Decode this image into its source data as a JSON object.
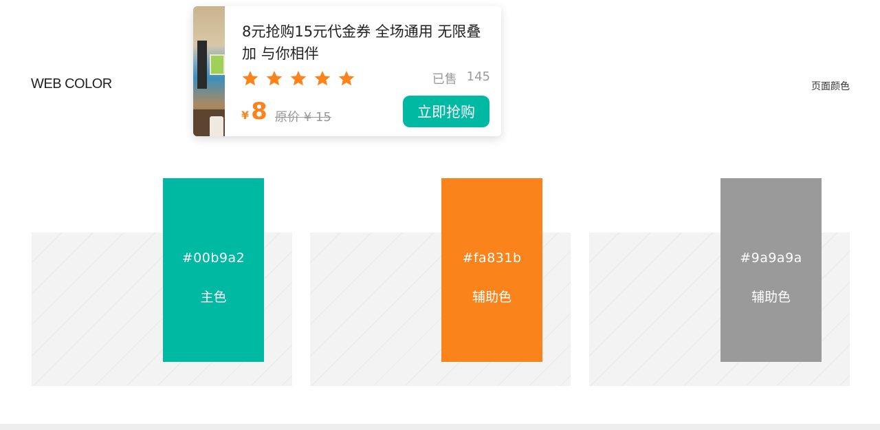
{
  "header": {
    "left_title": "WEB COLOR",
    "right_title": "页面颜色"
  },
  "coupon": {
    "title": "8元抢购15元代金券 全场通用 无限叠加 与你相伴",
    "rating_stars": 5,
    "sold_label": "已售",
    "sold_count": "145",
    "currency": "¥",
    "price": "8",
    "original_price": "原价 ¥ 15",
    "buy_label": "立即抢购"
  },
  "swatches": [
    {
      "hex": "#00b9a2",
      "role": "主色",
      "color": "#00b9a2"
    },
    {
      "hex": "#fa831b",
      "role": "辅助色",
      "color": "#fa831b"
    },
    {
      "hex": "#9a9a9a",
      "role": "辅助色",
      "color": "#9a9a9a"
    }
  ],
  "colors": {
    "primary": "#00b9a2",
    "accent": "#fa831b",
    "neutral": "#9a9a9a"
  },
  "icons": {
    "star": "star-icon"
  }
}
